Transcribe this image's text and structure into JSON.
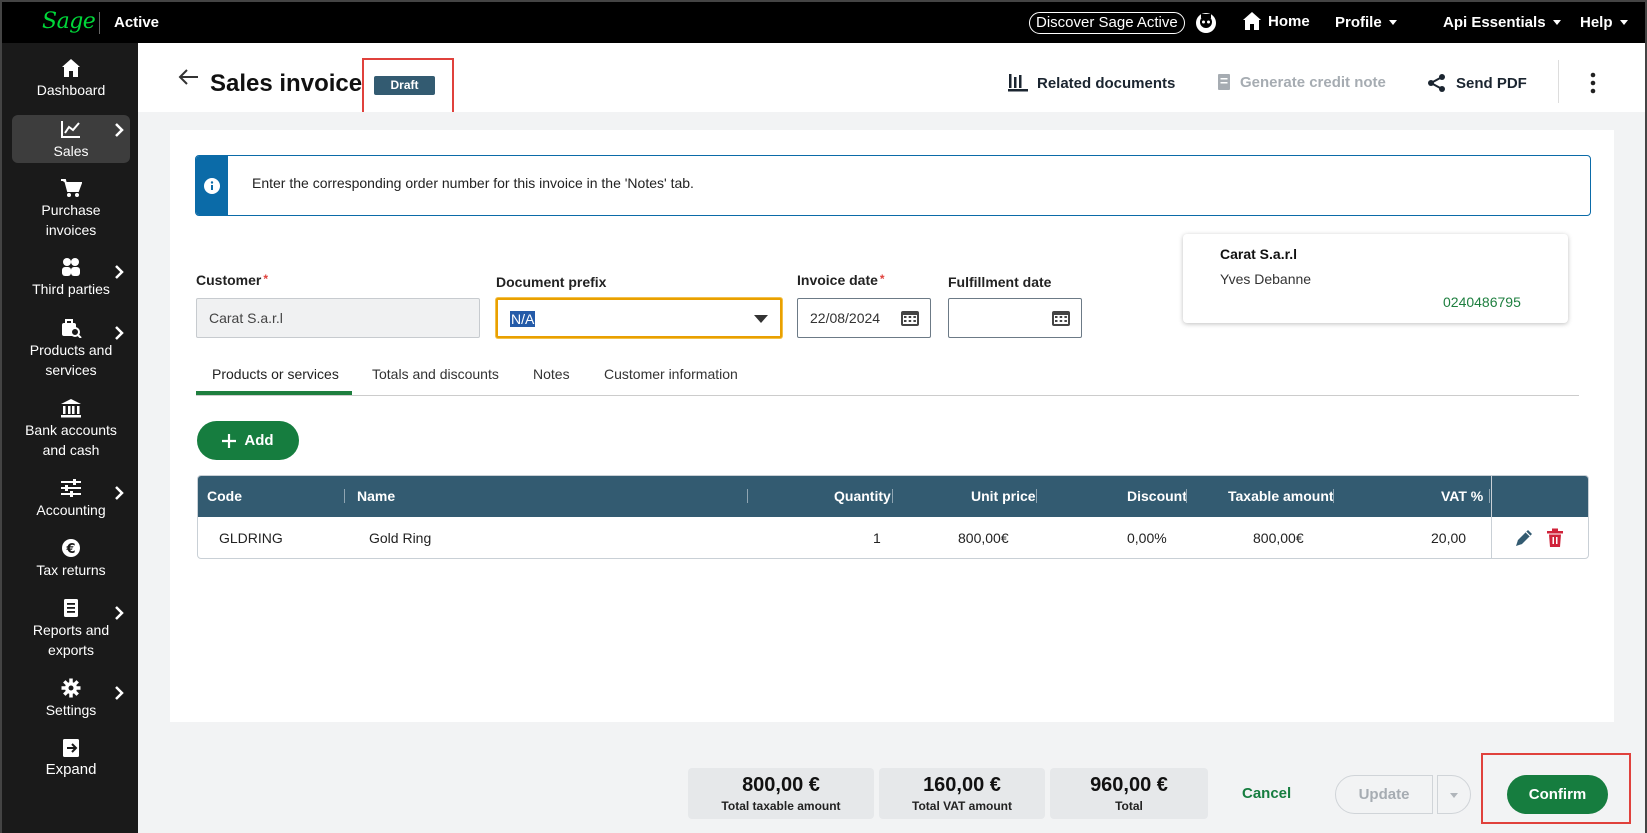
{
  "topbar": {
    "logo": "Sage",
    "app_name": "Active",
    "discover_label": "Discover Sage Active",
    "home_label": "Home",
    "profile_label": "Profile",
    "api_label": "Api Essentials",
    "help_label": "Help"
  },
  "sidebar": {
    "items": [
      {
        "label1": "Dashboard",
        "label2": "",
        "icon": "home-icon",
        "has_chevron": false
      },
      {
        "label1": "Sales",
        "label2": "",
        "icon": "chart-icon",
        "has_chevron": true,
        "active": true
      },
      {
        "label1": "Purchase",
        "label2": "invoices",
        "icon": "cart-icon",
        "has_chevron": false
      },
      {
        "label1": "Third parties",
        "label2": "",
        "icon": "people-icon",
        "has_chevron": true
      },
      {
        "label1": "Products and",
        "label2": "services",
        "icon": "box-search-icon",
        "has_chevron": true
      },
      {
        "label1": "Bank accounts",
        "label2": "and cash",
        "icon": "bank-icon",
        "has_chevron": false
      },
      {
        "label1": "Accounting",
        "label2": "",
        "icon": "sliders-icon",
        "has_chevron": true
      },
      {
        "label1": "Tax returns",
        "label2": "",
        "icon": "euro-icon",
        "has_chevron": false
      },
      {
        "label1": "Reports and",
        "label2": "exports",
        "icon": "report-icon",
        "has_chevron": true
      },
      {
        "label1": "Settings",
        "label2": "",
        "icon": "gear-icon",
        "has_chevron": true
      },
      {
        "label1": "Expand",
        "label2": "",
        "icon": "expand-icon",
        "has_chevron": false
      }
    ]
  },
  "header": {
    "title": "Sales invoice",
    "status_badge": "Draft",
    "related_documents": "Related documents",
    "generate_credit_note": "Generate credit note",
    "send_pdf": "Send PDF"
  },
  "info_banner": {
    "text": "Enter the corresponding order number for this invoice in the 'Notes' tab."
  },
  "form": {
    "customer_label": "Customer",
    "customer_value": "Carat S.a.r.l",
    "doc_prefix_label": "Document prefix",
    "doc_prefix_value": "N/A",
    "invoice_date_label": "Invoice date",
    "invoice_date_value": "22/08/2024",
    "fulfillment_date_label": "Fulfillment date",
    "fulfillment_date_value": "",
    "required_marker": "*"
  },
  "customer_card": {
    "name": "Carat S.a.r.l",
    "contact": "Yves Debanne",
    "phone": "0240486795"
  },
  "tabs": [
    {
      "label": "Products or services",
      "active": true
    },
    {
      "label": "Totals and discounts",
      "active": false
    },
    {
      "label": "Notes",
      "active": false
    },
    {
      "label": "Customer information",
      "active": false
    }
  ],
  "add_button": "Add",
  "table": {
    "headers": {
      "code": "Code",
      "name": "Name",
      "quantity": "Quantity",
      "unit_price": "Unit price",
      "discount": "Discount",
      "taxable_amount": "Taxable amount",
      "vat": "VAT %"
    },
    "rows": [
      {
        "code": "GLDRING",
        "name": "Gold Ring",
        "quantity": "1",
        "unit_price": "800,00€",
        "discount": "0,00%",
        "taxable_amount": "800,00€",
        "vat": "20,00"
      }
    ]
  },
  "totals": {
    "taxable": {
      "value": "800,00 €",
      "label": "Total taxable amount"
    },
    "vat": {
      "value": "160,00 €",
      "label": "Total VAT amount"
    },
    "total": {
      "value": "960,00 €",
      "label": "Total"
    }
  },
  "footer": {
    "cancel_label": "Cancel",
    "update_label": "Update",
    "confirm_label": "Confirm"
  },
  "colors": {
    "brand_green": "#167d3f",
    "header_blue": "#335b71",
    "info_blue": "#0b6ba8",
    "highlight_red": "#e0413c"
  }
}
